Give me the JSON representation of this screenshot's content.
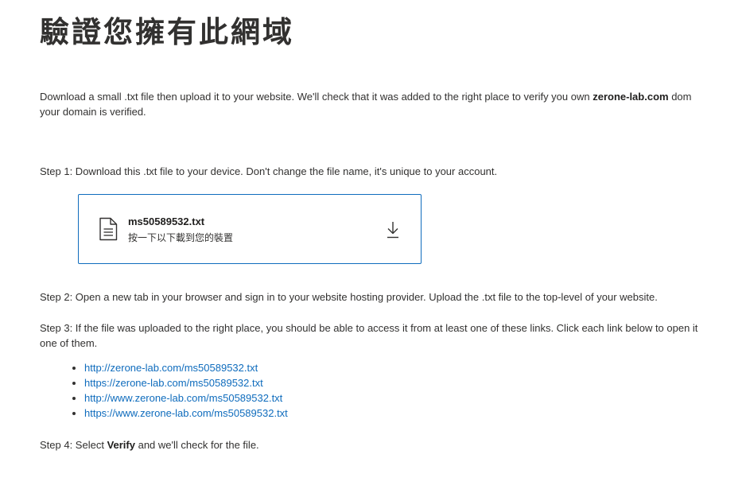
{
  "page": {
    "title": "驗證您擁有此網域"
  },
  "intro": {
    "text_before": "Download a small .txt file then upload it to your website. We'll check that it was added to the right place to verify you own ",
    "domain": "zerone-lab.com",
    "text_after": " dom",
    "line2": "your domain is verified."
  },
  "step1": {
    "text": "Step 1: Download this .txt file to your device. Don't change the file name, it's unique to your account."
  },
  "file_card": {
    "file_name": "ms50589532.txt",
    "hint": "按一下以下載到您的裝置",
    "file_icon": "document-icon",
    "download_icon": "download-icon"
  },
  "step2": {
    "text": "Step 2: Open a new tab in your browser and sign in to your website hosting provider. Upload the .txt file to the top-level of your website."
  },
  "step3": {
    "line1": "Step 3: If the file was uploaded to the right place, you should be able to access it from at least one of these links. Click each link below to open it",
    "line2": "one of them."
  },
  "links": [
    "http://zerone-lab.com/ms50589532.txt",
    "https://zerone-lab.com/ms50589532.txt",
    "http://www.zerone-lab.com/ms50589532.txt",
    "https://www.zerone-lab.com/ms50589532.txt"
  ],
  "step4": {
    "text_before": "Step 4: Select ",
    "verify": "Verify",
    "text_after": " and we'll check for the file."
  },
  "colors": {
    "accent": "#0f6cbd",
    "text": "#323130"
  }
}
